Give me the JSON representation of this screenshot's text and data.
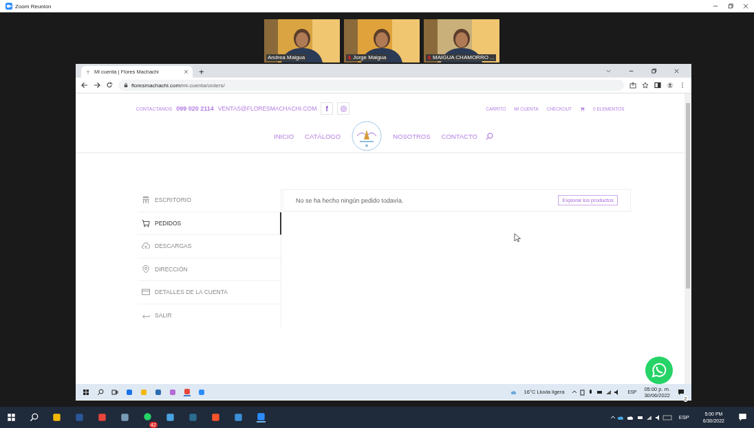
{
  "zoom_window": {
    "title": "Zoom Reunión"
  },
  "participants": [
    {
      "name": "Andrea Maigua",
      "muted": false
    },
    {
      "name": "Jorge Maigua",
      "muted": true
    },
    {
      "name": "MAIGUA CHAMORRO ...",
      "muted": true
    }
  ],
  "browser": {
    "tab_title": "Mi cuenta | Flores Machachi",
    "new_tab": "+",
    "url_domain": "floresmachachi.com",
    "url_path": "/mi-cuenta/orders/"
  },
  "site": {
    "contact_label": "CONTACTANOS",
    "phone": "099 020 2114",
    "email": "VENTAS@FLORESMACHACHI.COM",
    "facebook": "f",
    "top_links": [
      "CARRITO",
      "MI CUENTA",
      "CHECKOUT"
    ],
    "cart": "0 ELEMENTOS",
    "nav_left": [
      "INICIO",
      "CATÁLOGO"
    ],
    "nav_right": [
      "NOSOTROS",
      "CONTACTO"
    ]
  },
  "account_menu": [
    {
      "label": "ESCRITORIO",
      "kind": "desk",
      "selected": false
    },
    {
      "label": "PEDIDOS",
      "kind": "cart",
      "selected": true
    },
    {
      "label": "DESCARGAS",
      "kind": "cloud",
      "selected": false
    },
    {
      "label": "DIRECCIÓN",
      "kind": "pin",
      "selected": false
    },
    {
      "label": "DETALLES DE LA CUENTA",
      "kind": "card",
      "selected": false
    },
    {
      "label": "SALIR",
      "kind": "exit",
      "selected": false
    }
  ],
  "orders": {
    "message": "No se ha hecho ningún pedido todavía.",
    "button": "Explorar los productos"
  },
  "inner_taskbar": {
    "weather": "16°C Lluvia ligera",
    "language": "ESP",
    "time": "05:00 p. m.",
    "date": "30/06/2022",
    "notifications": "2"
  },
  "outer_taskbar": {
    "whatsapp_badge": "42",
    "language": "ESP",
    "time": "5:00 PM",
    "date": "6/30/2022"
  }
}
